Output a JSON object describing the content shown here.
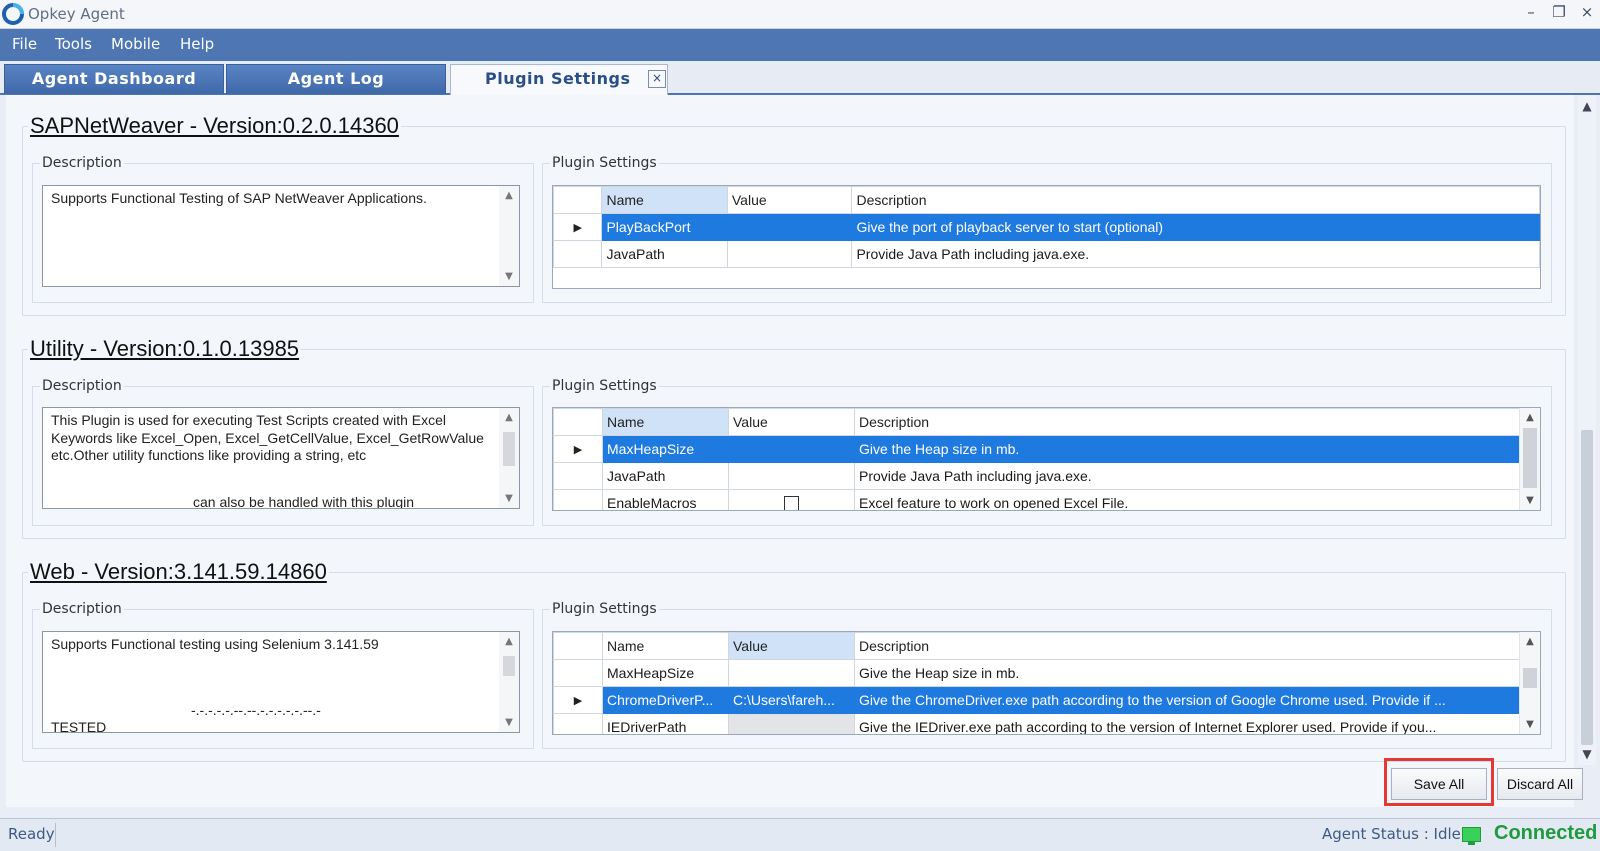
{
  "window": {
    "title": "Opkey Agent",
    "controls": [
      "–",
      "❐",
      "×"
    ]
  },
  "menu": [
    "File",
    "Tools",
    "Mobile",
    "Help"
  ],
  "tabs": [
    {
      "label": "Agent  Dashboard"
    },
    {
      "label": "Agent  Log"
    },
    {
      "label": "Plugin  Settings"
    }
  ],
  "tab_close": "×",
  "labels": {
    "description": "Description",
    "plugin_settings": "Plugin Settings"
  },
  "grid_headers": {
    "name": "Name",
    "value": "Value",
    "description": "Description"
  },
  "row_indicator": "▶",
  "plugins": [
    {
      "title": "SAPNetWeaver - Version:0.2.0.14360",
      "description": "Supports Functional Testing of SAP NetWeaver Applications.",
      "sorted_column": "name",
      "rows": [
        {
          "name": "PlayBackPort",
          "value": "",
          "description": "Give the port of playback server to start (optional)",
          "selected": true
        },
        {
          "name": "JavaPath",
          "value": "",
          "description": "Provide Java Path including java.exe."
        }
      ]
    },
    {
      "title": "Utility - Version:0.1.0.13985",
      "description": "This Plugin is used for executing Test Scripts created with Excel Keywords like Excel_Open, Excel_GetCellValue, Excel_GetRowValue etc.Other utility functions like providing a string, etc",
      "description_tail": "can also be handled with this plugin",
      "sorted_column": "name",
      "rows": [
        {
          "name": "MaxHeapSize",
          "value": "",
          "description": "Give the Heap size in mb.",
          "selected": true
        },
        {
          "name": "JavaPath",
          "value": "",
          "description": "Provide Java Path including java.exe."
        },
        {
          "name": "EnableMacros",
          "value": "",
          "description": "Excel feature to work on opened Excel File.",
          "checkbox": true
        }
      ]
    },
    {
      "title": "Web - Version:3.141.59.14860",
      "description": "Supports Functional testing using Selenium 3.141.59",
      "description_tail": "-.-.-.-.-.--.--.-.-.-.-.-.--.-",
      "description_tail2": "TESTED",
      "sorted_column": "value",
      "rows": [
        {
          "name": "MaxHeapSize",
          "value": "",
          "description": "Give the Heap size in mb."
        },
        {
          "name": "ChromeDriverP...",
          "value": "C:\\Users\\fareh...",
          "description": "Give the ChromeDriver.exe path according to the version of Google Chrome used. Provide if ...",
          "selected": true
        },
        {
          "name": "IEDriverPath",
          "value": "",
          "description": "Give the IEDriver.exe path according to the version of Internet Explorer used. Provide if you..."
        }
      ]
    }
  ],
  "buttons": {
    "save_all": "Save All",
    "discard_all": "Discard All"
  },
  "status": {
    "ready": "Ready",
    "agent_status": "Agent Status : Idle",
    "connection": "Connected"
  },
  "colors": {
    "menu_bar": "#4d76b3",
    "selection": "#1f7adf",
    "connected": "#1f9a3c",
    "highlight": "#e53935"
  }
}
